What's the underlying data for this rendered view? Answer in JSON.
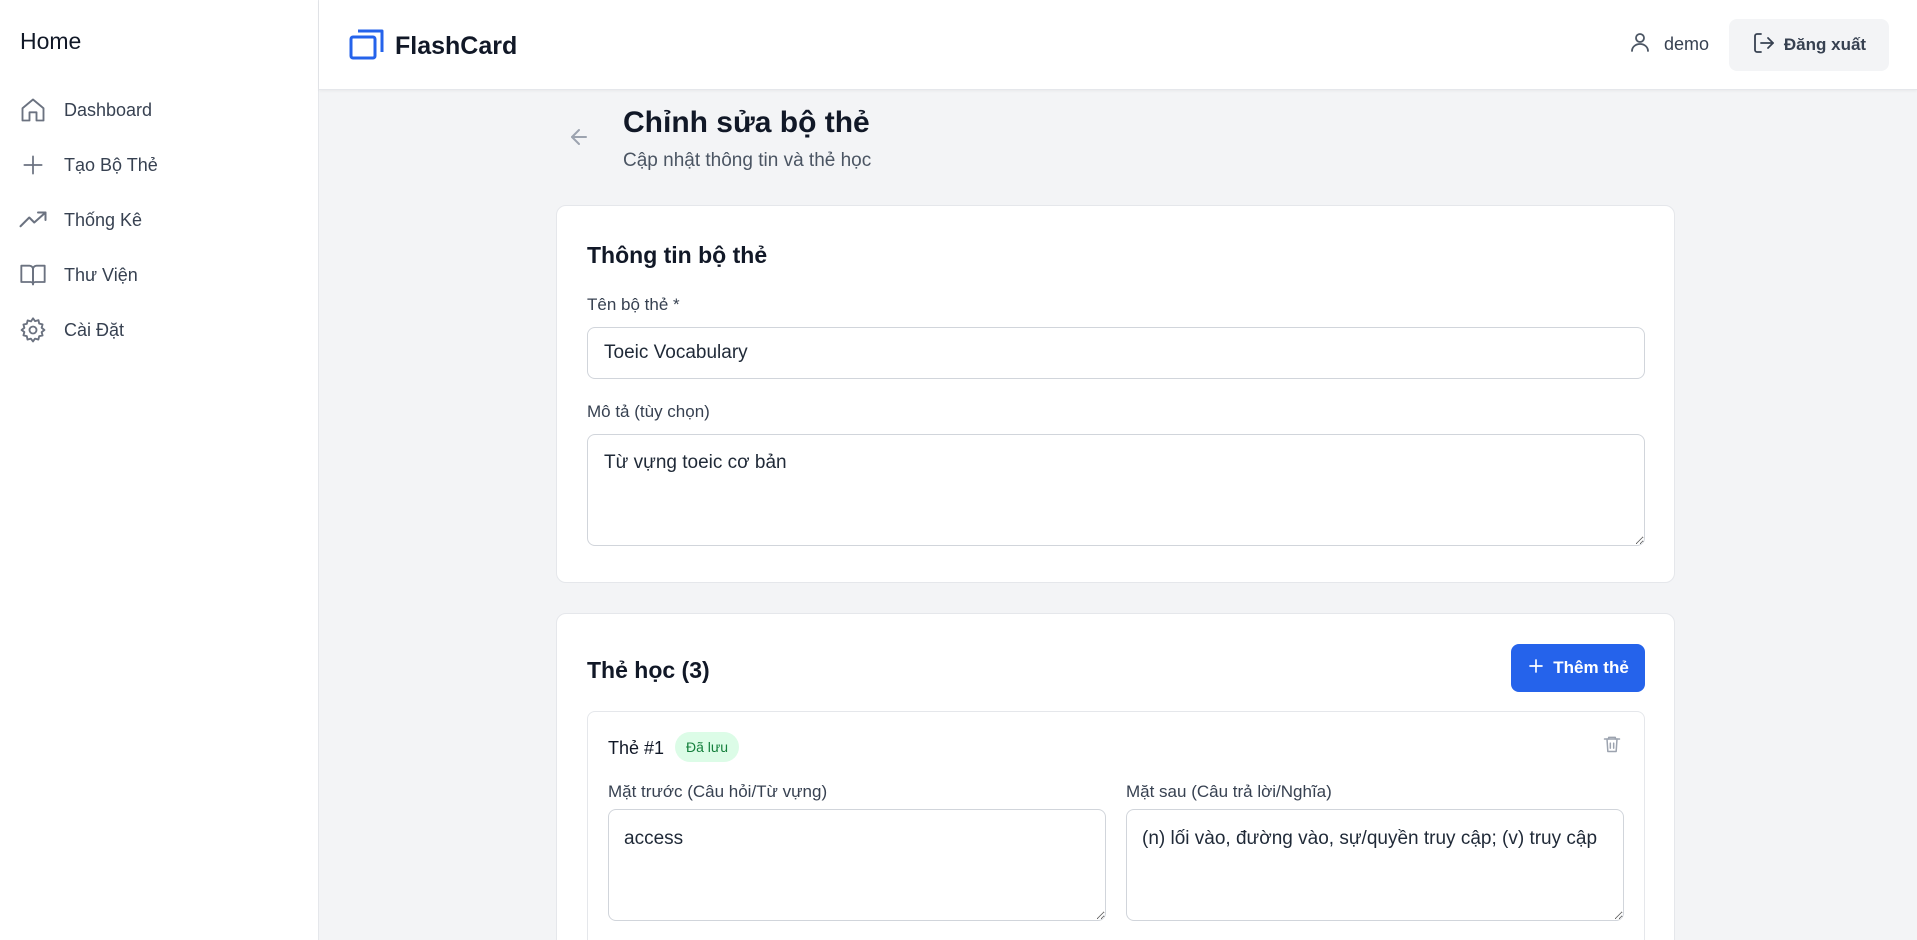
{
  "sidebar": {
    "title": "Home",
    "items": [
      {
        "label": "Dashboard",
        "icon": "home-icon"
      },
      {
        "label": "Tạo Bộ Thẻ",
        "icon": "plus-icon"
      },
      {
        "label": "Thống Kê",
        "icon": "trending-up-icon"
      },
      {
        "label": "Thư Viện",
        "icon": "book-icon"
      },
      {
        "label": "Cài Đặt",
        "icon": "gear-icon"
      }
    ]
  },
  "header": {
    "brand": "FlashCard",
    "user_name": "demo",
    "logout_label": "Đăng xuất"
  },
  "page": {
    "title": "Chỉnh sửa bộ thẻ",
    "subtitle": "Cập nhật thông tin và thẻ học"
  },
  "deck_info": {
    "heading": "Thông tin bộ thẻ",
    "name_label": "Tên bộ thẻ *",
    "name_value": "Toeic Vocabulary",
    "description_label": "Mô tả (tùy chọn)",
    "description_value": "Từ vựng toeic cơ bản"
  },
  "cards_section": {
    "heading": "Thẻ học (3)",
    "add_label": "Thêm thẻ",
    "cards": [
      {
        "title": "Thẻ #1",
        "status": "Đã lưu",
        "front_label": "Mặt trước (Câu hỏi/Từ vựng)",
        "front_value": "access",
        "back_label": "Mặt sau (Câu trả lời/Nghĩa)",
        "back_value": "(n) lối vào, đường vào, sự/quyền truy cập; (v) truy cập"
      }
    ]
  },
  "colors": {
    "primary": "#2563eb",
    "brand_icon": "#2563eb",
    "badge_bg": "#dcfce7",
    "badge_text": "#15803d"
  }
}
